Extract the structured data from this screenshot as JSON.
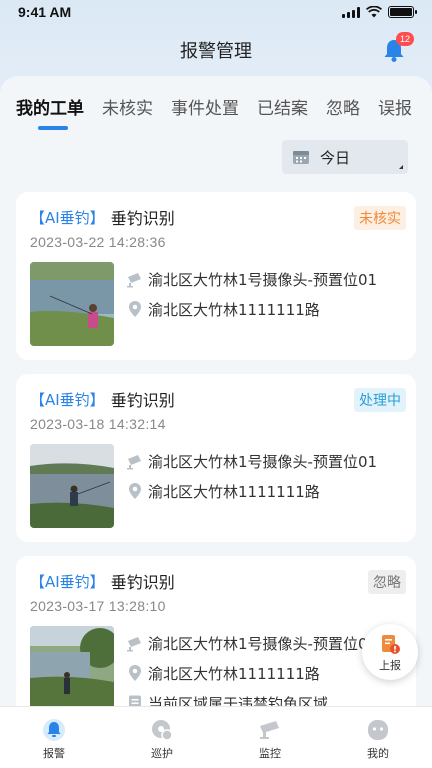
{
  "status_bar": {
    "time": "9:41 AM"
  },
  "header": {
    "title": "报警管理",
    "notification_count": "12"
  },
  "tabs": [
    {
      "label": "我的工单",
      "active": true
    },
    {
      "label": "未核实",
      "active": false
    },
    {
      "label": "事件处置",
      "active": false
    },
    {
      "label": "已结案",
      "active": false
    },
    {
      "label": "忽略",
      "active": false
    },
    {
      "label": "误报",
      "active": false
    }
  ],
  "date_filter": {
    "value": "今日"
  },
  "cards": [
    {
      "tag": "【AI垂钓】",
      "title": "垂钓识别",
      "status": "未核实",
      "time": "2023-03-22 14:28:36",
      "camera": "渝北区大竹林1号摄像头-预置位01",
      "address": "渝北区大竹林1111111路"
    },
    {
      "tag": "【AI垂钓】",
      "title": "垂钓识别",
      "status": "处理中",
      "time": "2023-03-18 14:32:14",
      "camera": "渝北区大竹林1号摄像头-预置位01",
      "address": "渝北区大竹林1111111路"
    },
    {
      "tag": "【AI垂钓】",
      "title": "垂钓识别",
      "status": "忽略",
      "time": "2023-03-17 13:28:10",
      "camera": "渝北区大竹林1号摄像头-预置位01",
      "address": "渝北区大竹林1111111路",
      "note": "当前区域属于违禁钓鱼区域"
    }
  ],
  "fab": {
    "label": "上报"
  },
  "bottom_nav": [
    {
      "label": "报警",
      "icon": "alarm-icon"
    },
    {
      "label": "巡护",
      "icon": "patrol-icon"
    },
    {
      "label": "监控",
      "icon": "camera-icon"
    },
    {
      "label": "我的",
      "icon": "profile-icon"
    }
  ],
  "colors": {
    "accent": "#2a83e8",
    "status_unverified": "#f0893a",
    "status_processing": "#2a9fd8",
    "status_ignored": "#777777"
  }
}
